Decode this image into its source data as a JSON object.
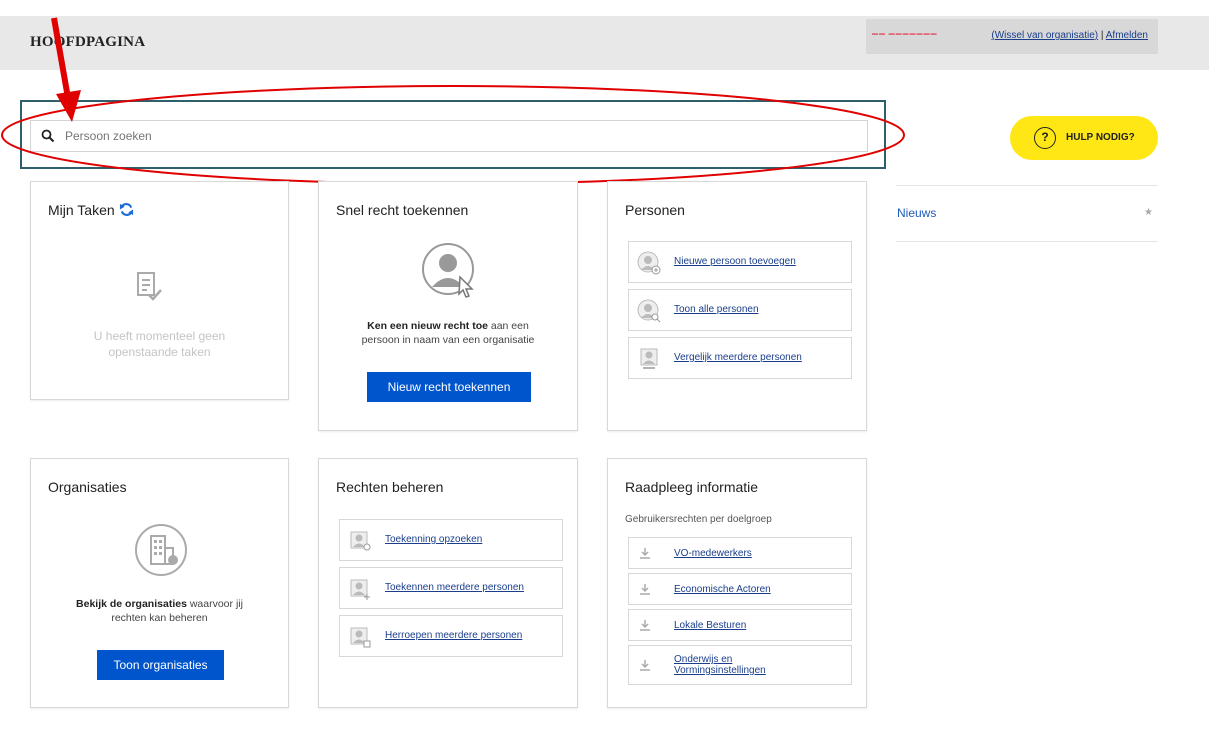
{
  "header": {
    "title": "HOOFDPAGINA",
    "switch_org": "(Wissel van organisatie)",
    "separator": "|",
    "logout": "Afmelden"
  },
  "search": {
    "placeholder": "Persoon zoeken"
  },
  "help": {
    "label": "HULP NODIG?"
  },
  "news": {
    "label": "Nieuws"
  },
  "cards": {
    "tasks": {
      "title": "Mijn Taken",
      "empty_line1": "U heeft momenteel geen",
      "empty_line2": "openstaande taken"
    },
    "quick_grant": {
      "title": "Snel recht toekennen",
      "text_bold": "Ken een nieuw recht toe",
      "text_rest": " aan een",
      "text_line2": "persoon in naam van een organisatie",
      "button": "Nieuw recht toekennen"
    },
    "persons": {
      "title": "Personen",
      "links": [
        "Nieuwe persoon toevoegen",
        "Toon alle personen",
        "Vergelijk meerdere personen"
      ]
    },
    "organisations": {
      "title": "Organisaties",
      "text_bold": "Bekijk de organisaties",
      "text_rest": " waarvoor jij",
      "text_line2": "rechten kan beheren",
      "button": "Toon organisaties"
    },
    "rights": {
      "title": "Rechten beheren",
      "links": [
        "Toekenning opzoeken",
        "Toekennen meerdere personen",
        "Herroepen meerdere personen"
      ]
    },
    "info": {
      "title": "Raadpleeg informatie",
      "subtitle": "Gebruikersrechten per doelgroep",
      "links": [
        "VO-medewerkers",
        "Economische Actoren",
        "Lokale Besturen"
      ],
      "link4_line1": "Onderwijs en",
      "link4_line2": "Vormingsinstellingen"
    }
  },
  "colors": {
    "primary_button": "#0055cc",
    "help_button": "#ffe615",
    "link": "#1a3e8c",
    "annotation": "#e00000",
    "search_frame": "#2e5f6b"
  },
  "icons": [
    "search-icon",
    "refresh-icon",
    "task-list-icon",
    "person-pointer-icon",
    "person-add-icon",
    "person-search-icon",
    "persons-compare-icon",
    "building-icon",
    "download-icon",
    "question-icon",
    "star-icon",
    "arrow-annotation"
  ]
}
